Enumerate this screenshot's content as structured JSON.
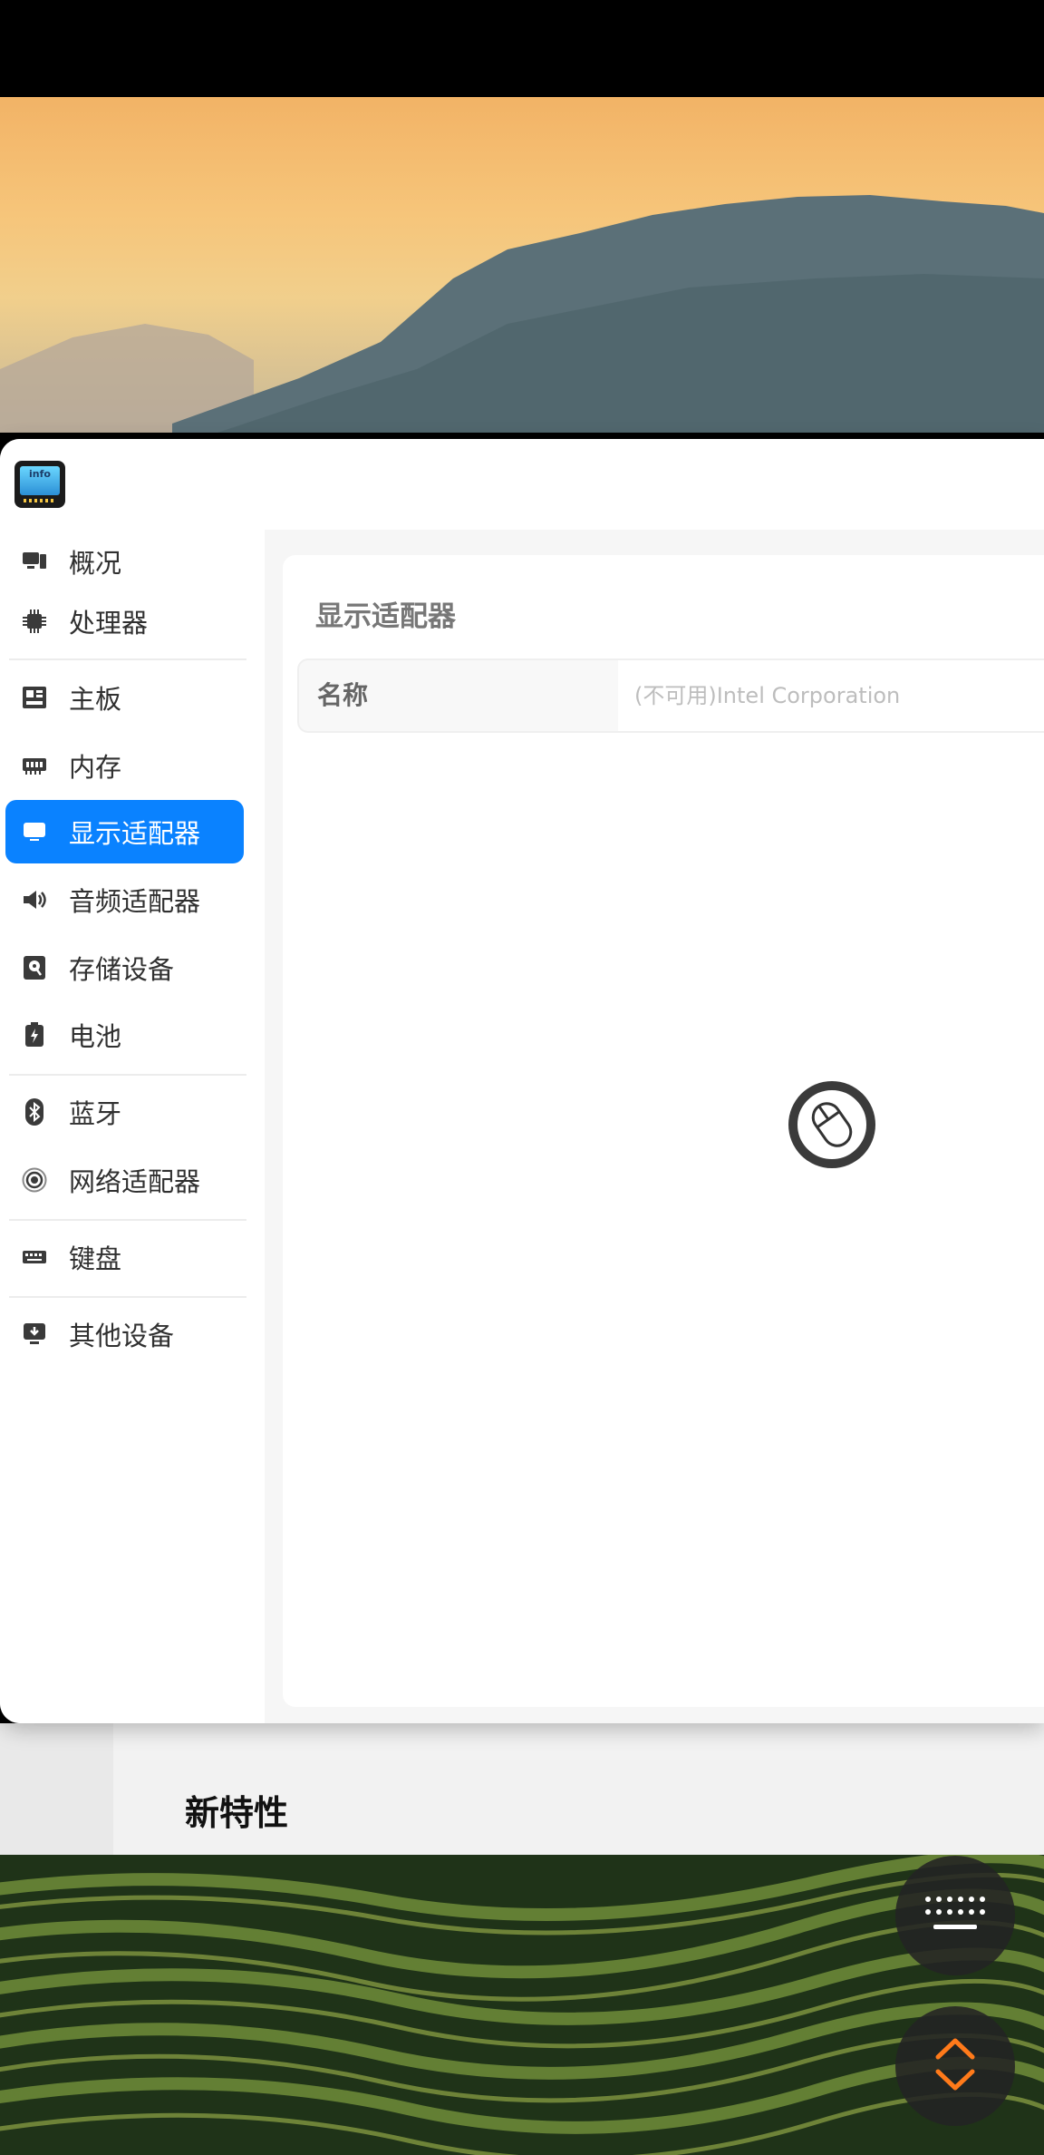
{
  "sidebar": {
    "items": [
      {
        "key": "overview",
        "label": "概况",
        "icon": "monitor-icon"
      },
      {
        "key": "cpu",
        "label": "处理器",
        "icon": "cpu-icon"
      },
      {
        "key": "motherboard",
        "label": "主板",
        "icon": "motherboard-icon"
      },
      {
        "key": "memory",
        "label": "内存",
        "icon": "memory-icon"
      },
      {
        "key": "display",
        "label": "显示适配器",
        "icon": "display-adapter-icon"
      },
      {
        "key": "audio",
        "label": "音频适配器",
        "icon": "speaker-icon"
      },
      {
        "key": "storage",
        "label": "存储设备",
        "icon": "storage-icon"
      },
      {
        "key": "battery",
        "label": "电池",
        "icon": "battery-icon"
      },
      {
        "key": "bluetooth",
        "label": "蓝牙",
        "icon": "bluetooth-icon"
      },
      {
        "key": "network",
        "label": "网络适配器",
        "icon": "network-icon"
      },
      {
        "key": "keyboard",
        "label": "键盘",
        "icon": "keyboard-icon"
      },
      {
        "key": "other",
        "label": "其他设备",
        "icon": "other-devices-icon"
      }
    ],
    "active": "display"
  },
  "content": {
    "section_title": "显示适配器",
    "rows": [
      {
        "key": "名称",
        "value": "(不可用)Intel Corporation"
      }
    ]
  },
  "background_page": {
    "title": "新特性"
  },
  "app": {
    "icon_text": "info"
  },
  "colors": {
    "accent": "#0a82ff",
    "fab_arrow": "#ff7a1a"
  }
}
